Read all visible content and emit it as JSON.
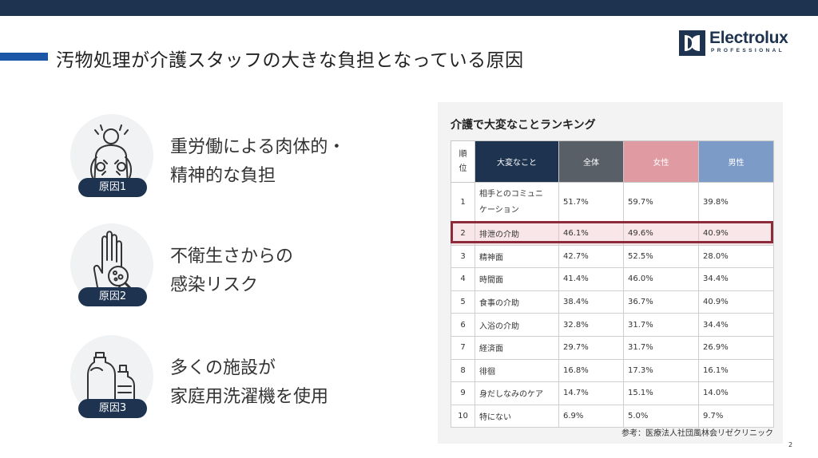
{
  "title": "汚物処理が介護スタッフの大きな負担となっている原因",
  "logo": {
    "name": "Electrolux",
    "sub": "PROFESSIONAL"
  },
  "causes": [
    {
      "badge": "原因1",
      "lines": [
        "重労働による肉体的・",
        "精神的な負担"
      ],
      "icon": "back-pain-icon"
    },
    {
      "badge": "原因2",
      "lines": [
        "不衛生さからの",
        "感染リスク"
      ],
      "icon": "germ-hand-icon"
    },
    {
      "badge": "原因3",
      "lines": [
        "多くの施設が",
        "家庭用洗濯機を使用"
      ],
      "icon": "detergent-bottles-icon"
    }
  ],
  "ranking": {
    "title": "介護で大変なことランキング",
    "headers": {
      "rank": "順\n位",
      "item": "大変なこと",
      "all": "全体",
      "female": "女性",
      "male": "男性"
    },
    "rows": [
      {
        "rank": "1",
        "item": "相手とのコミュニケーション",
        "all": "51.7%",
        "female": "59.7%",
        "male": "39.8%"
      },
      {
        "rank": "2",
        "item": "排泄の介助",
        "all": "46.1%",
        "female": "49.6%",
        "male": "40.9%"
      },
      {
        "rank": "3",
        "item": "精神面",
        "all": "42.7%",
        "female": "52.5%",
        "male": "28.0%"
      },
      {
        "rank": "4",
        "item": "時間面",
        "all": "41.4%",
        "female": "46.0%",
        "male": "34.4%"
      },
      {
        "rank": "5",
        "item": "食事の介助",
        "all": "38.4%",
        "female": "36.7%",
        "male": "40.9%"
      },
      {
        "rank": "6",
        "item": "入浴の介助",
        "all": "32.8%",
        "female": "31.7%",
        "male": "34.4%"
      },
      {
        "rank": "7",
        "item": "経済面",
        "all": "29.7%",
        "female": "31.7%",
        "male": "26.9%"
      },
      {
        "rank": "8",
        "item": "徘徊",
        "all": "16.8%",
        "female": "17.3%",
        "male": "16.1%"
      },
      {
        "rank": "9",
        "item": "身だしなみのケア",
        "all": "14.7%",
        "female": "15.1%",
        "male": "14.0%"
      },
      {
        "rank": "10",
        "item": "特にない",
        "all": "6.9%",
        "female": "5.0%",
        "male": "9.7%"
      }
    ],
    "highlight_rank": "2",
    "source": "参考：医療法人社団風林会リゼクリニック"
  },
  "colors": {
    "navy": "#1d3350",
    "accent_blue": "#1b57a6",
    "highlight": "#8d2b3b",
    "female": "#df9aa2",
    "male": "#7c9bc6",
    "all": "#585f66"
  },
  "page_number": "2"
}
